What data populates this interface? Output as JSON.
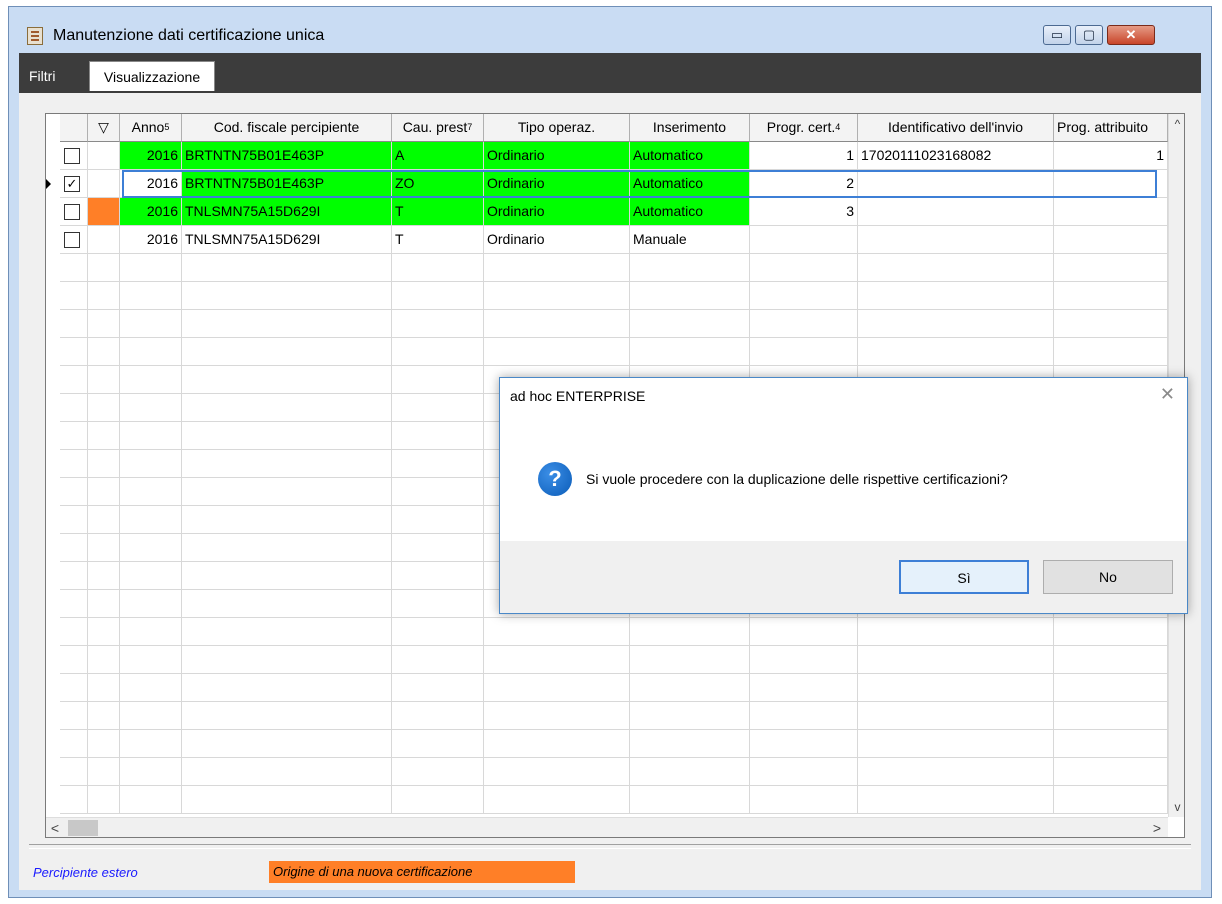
{
  "window": {
    "title": "Manutenzione dati certificazione unica",
    "controls": {
      "minimize": "▭",
      "maximize": "▢",
      "close": "✕"
    }
  },
  "tabs": {
    "filtri": "Filtri",
    "visualizzazione": "Visualizzazione"
  },
  "grid": {
    "headers": {
      "anno": "Anno",
      "anno_sort": "5",
      "cod_fiscale": "Cod. fiscale percipiente",
      "cau_prest": "Cau. prest",
      "cau_prest_sort": "7",
      "tipo_operaz": "Tipo operaz.",
      "inserimento": "Inserimento",
      "progr_cert": "Progr. cert.",
      "progr_cert_sort": "4",
      "identificativo": "Identificativo dell'invio",
      "prog_attribuito": "Prog. attribuito"
    },
    "rows": [
      {
        "checked": "",
        "anno": "2016",
        "cod_fiscale": "BRTNTN75B01E463P",
        "cau_prest": "A",
        "tipo_operaz": "Ordinario",
        "inserimento": "Automatico",
        "progr_cert": "1",
        "identificativo": "17020111023168082",
        "prog_attribuito": "1"
      },
      {
        "checked": "✓",
        "anno": "2016",
        "cod_fiscale": "BRTNTN75B01E463P",
        "cau_prest": "ZO",
        "tipo_operaz": "Ordinario",
        "inserimento": "Automatico",
        "progr_cert": "2",
        "identificativo": "",
        "prog_attribuito": ""
      },
      {
        "checked": "",
        "anno": "2016",
        "cod_fiscale": "TNLSMN75A15D629I",
        "cau_prest": "T",
        "tipo_operaz": "Ordinario",
        "inserimento": "Automatico",
        "progr_cert": "3",
        "identificativo": "",
        "prog_attribuito": ""
      },
      {
        "checked": "",
        "anno": "2016",
        "cod_fiscale": "TNLSMN75A15D629I",
        "cau_prest": "T",
        "tipo_operaz": "Ordinario",
        "inserimento": "Manuale",
        "progr_cert": "",
        "identificativo": "",
        "prog_attribuito": ""
      }
    ]
  },
  "scrollbars": {
    "up": "^",
    "down": "v",
    "left": "<",
    "right": ">"
  },
  "legend": {
    "percipiente_estero": "Percipiente estero",
    "origine": "Origine di una nuova certificazione"
  },
  "colors": {
    "highlight_green": "#00ff00",
    "origin_orange": "#ff7f27",
    "legend_blue": "#1a1aff",
    "selection_blue": "#3d7fd6"
  },
  "dialog": {
    "title": "ad hoc ENTERPRISE",
    "close": "✕",
    "icon": "?",
    "message": "Si vuole procedere con la duplicazione delle rispettive certificazioni?",
    "yes": "Sì",
    "no": "No"
  }
}
